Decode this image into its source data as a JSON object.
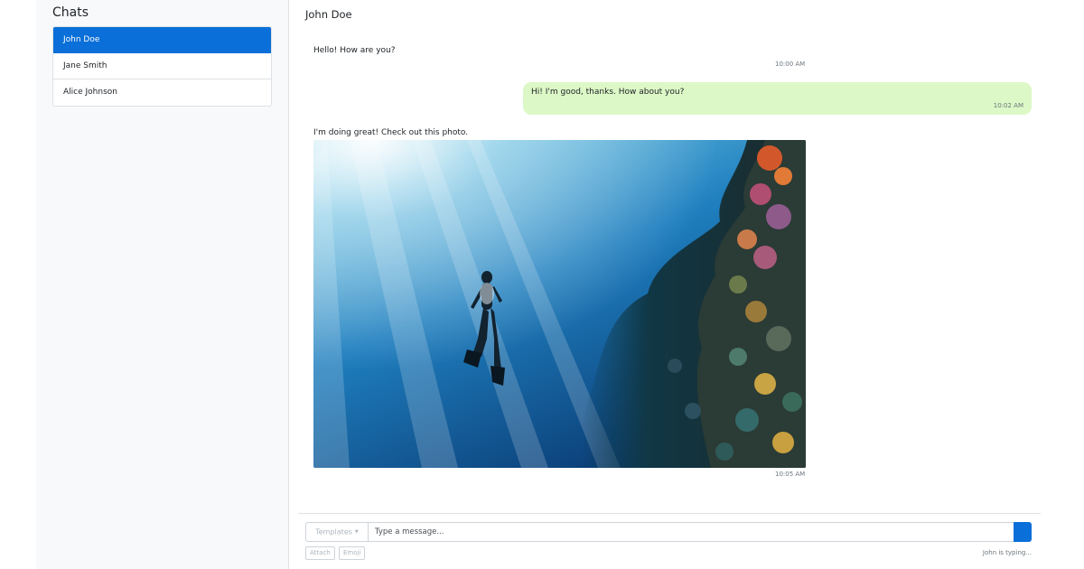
{
  "sidebar": {
    "title": "Chats",
    "items": [
      {
        "label": "John Doe",
        "active": true
      },
      {
        "label": "Jane Smith",
        "active": false
      },
      {
        "label": "Alice Johnson",
        "active": false
      }
    ]
  },
  "conversation": {
    "contact_name": "John Doe",
    "messages": [
      {
        "direction": "received",
        "text": "Hello! How are you?",
        "time": "10:00 AM"
      },
      {
        "direction": "sent",
        "text": "Hi! I'm good, thanks. How about you?",
        "time": "10:02 AM"
      },
      {
        "direction": "received",
        "text": "I'm doing great! Check out this photo.",
        "time": "10:05 AM",
        "attachment": "photo-underwater-diver-coral-reef"
      }
    ]
  },
  "composer": {
    "templates_label": "Templates",
    "input_placeholder": "Type a message...",
    "input_value": "",
    "send_icon": "send-icon",
    "attach_label": "Attach",
    "emoji_label": "Emoji",
    "typing_status": "John is typing..."
  },
  "colors": {
    "accent": "#0a6fd8",
    "sent_bubble": "#dcf8c6",
    "sidebar_bg": "#f8f9fa"
  }
}
